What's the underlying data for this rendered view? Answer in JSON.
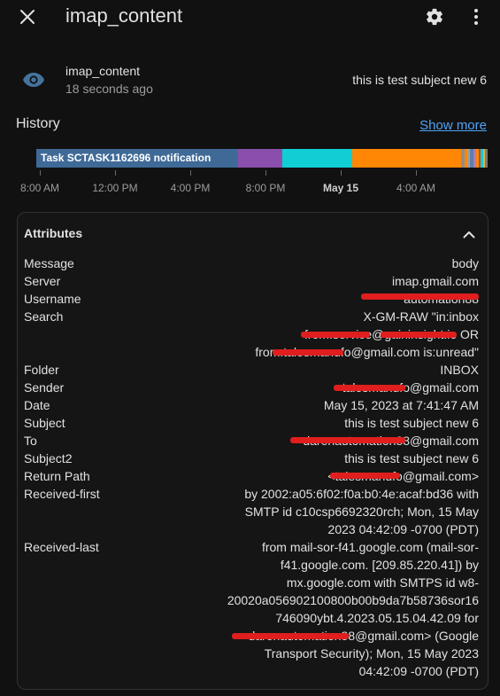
{
  "dialog": {
    "title": "imap_content",
    "close_icon": "close-icon",
    "settings_icon": "gear-icon",
    "menu_icon": "more-vertical-icon"
  },
  "entity": {
    "icon": "eye-icon",
    "name": "imap_content",
    "last_changed": "18 seconds ago",
    "state": "this is test subject new 6"
  },
  "history": {
    "title": "History",
    "show_more": "Show more",
    "bar_label": "Task SCTASK1162696 notification",
    "axis_labels": [
      "8:00 AM",
      "12:00 PM",
      "4:00 PM",
      "8:00 PM",
      "May 15",
      "4:00 AM"
    ],
    "colors": {
      "blue": "#3f6a97",
      "purple": "#8a4fad",
      "cyan": "#11cdd4",
      "orange": "#ff8705"
    }
  },
  "attributes": {
    "title": "Attributes",
    "collapse_icon": "chevron-up-icon",
    "rows": [
      {
        "key": "Message",
        "lines": [
          "body"
        ]
      },
      {
        "key": "Server",
        "lines": [
          "imap.gmail.com"
        ]
      },
      {
        "key": "Username",
        "lines": [
          "automation88"
        ]
      },
      {
        "key": "Search",
        "lines": [
          "X-GM-RAW \"in:inbox",
          "from:service@gaininsight.io OR",
          "from:talesmanufo@gmail.com is:unread\""
        ]
      },
      {
        "key": "Folder",
        "lines": [
          "INBOX"
        ]
      },
      {
        "key": "Sender",
        "lines": [
          "talesmanufo@gmail.com"
        ]
      },
      {
        "key": "Date",
        "lines": [
          "May 15, 2023 at 7:41:47 AM"
        ]
      },
      {
        "key": "Subject",
        "lines": [
          "this is test subject new 6"
        ]
      },
      {
        "key": "To",
        "lines": [
          "darenautomation88@gmail.com"
        ]
      },
      {
        "key": "Subject2",
        "lines": [
          "this is test subject new 6"
        ]
      },
      {
        "key": "Return Path",
        "lines": [
          "<talesmanufo@gmail.com>"
        ]
      },
      {
        "key": "Received-first",
        "lines": [
          "by 2002:a05:6f02:f0a:b0:4e:acaf:bd36 with",
          "SMTP id c10csp6692320rch; Mon, 15 May",
          "2023 04:42:09 -0700 (PDT)"
        ]
      },
      {
        "key": "Received-last",
        "lines": [
          "from mail-sor-f41.google.com (mail-sor-",
          "f41.google.com. [209.85.220.41]) by",
          "mx.google.com with SMTPS id w8-",
          "20020a056902100800b00b9da7b58736sor16",
          "746090ybt.4.2023.05.15.04.42.09 for",
          "<darenautomation88@gmail.com> (Google",
          "Transport Security); Mon, 15 May 2023",
          "04:42:09 -0700 (PDT)"
        ]
      }
    ]
  }
}
